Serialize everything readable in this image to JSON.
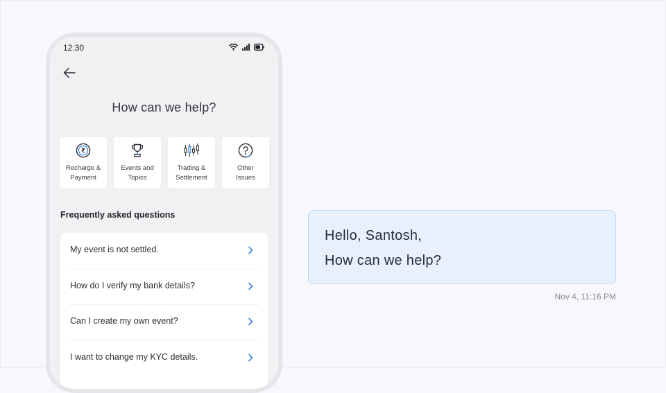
{
  "status_bar": {
    "time": "12:30"
  },
  "screen": {
    "title": "How can we help?",
    "categories": [
      {
        "icon": "rupee-coin-icon",
        "label": "Recharge &\nPayment"
      },
      {
        "icon": "trophy-icon",
        "label": "Events and\nTopics"
      },
      {
        "icon": "candlestick-chart-icon",
        "label": "Trading &\nSettlement"
      },
      {
        "icon": "question-circle-icon",
        "label": "Other\nIssues"
      }
    ],
    "faq_heading": "Frequently asked questions",
    "faq": [
      "My event is not settled.",
      "How do I verify my bank details?",
      "Can I create my own event?",
      "I want to change my KYC details."
    ]
  },
  "chat": {
    "greeting": "Hello, Santosh,",
    "question": "How can we help?",
    "timestamp": "Nov 4, 11:16 PM"
  },
  "colors": {
    "page_bg": "#f8f7fb",
    "bubble_bg": "#e7f1fd",
    "bubble_border": "#bcd8f7",
    "accent": "#3b82d6"
  }
}
